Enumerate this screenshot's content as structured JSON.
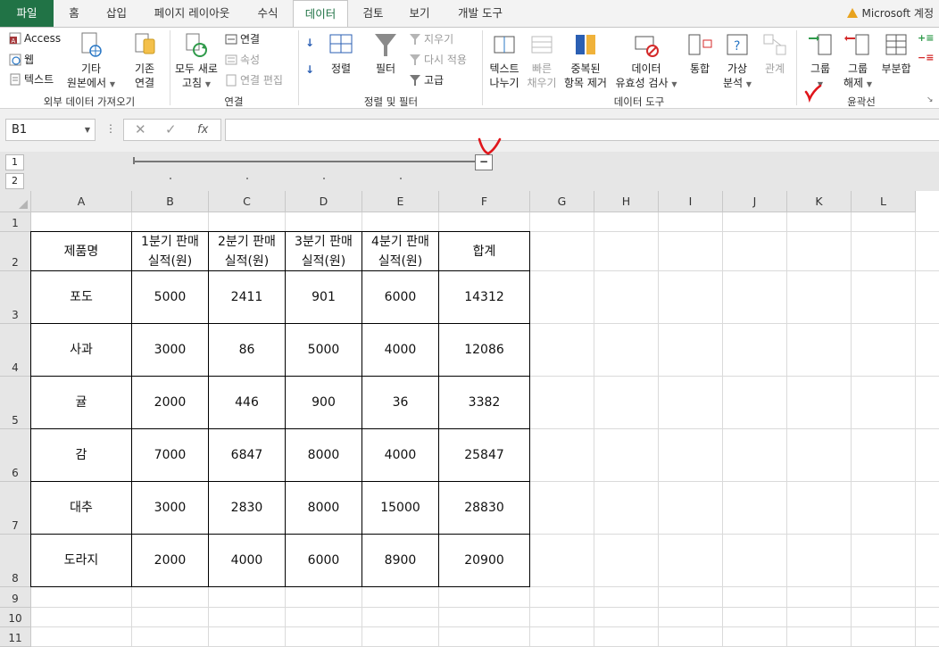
{
  "tabs": [
    "파일",
    "홈",
    "삽입",
    "페이지 레이아웃",
    "수식",
    "데이터",
    "검토",
    "보기",
    "개발 도구"
  ],
  "account": "Microsoft 계정",
  "ribbon": {
    "external": {
      "access": "Access",
      "web": "웹",
      "text": "텍스트",
      "other_line1": "기타",
      "other_line2": "원본에서",
      "existing_line1": "기존",
      "existing_line2": "연결",
      "group_label": "외부 데이터 가져오기"
    },
    "connections": {
      "refresh_line1": "모두 새로",
      "refresh_line2": "고침",
      "connections": "연결",
      "properties": "속성",
      "edit_links": "연결 편집",
      "group_label": "연결"
    },
    "sort_filter": {
      "sort": "정렬",
      "filter": "필터",
      "clear": "지우기",
      "reapply": "다시 적용",
      "advanced": "고급",
      "group_label": "정렬 및 필터"
    },
    "data_tools": {
      "text_to_columns_line1": "텍스트",
      "text_to_columns_line2": "나누기",
      "flash_fill_line1": "빠른",
      "flash_fill_line2": "채우기",
      "remove_dup_line1": "중복된",
      "remove_dup_line2": "항목 제거",
      "validation_line1": "데이터",
      "validation_line2": "유효성 검사",
      "consolidate": "통합",
      "whatif_line1": "가상",
      "whatif_line2": "분석",
      "relationships": "관계",
      "group_label": "데이터 도구"
    },
    "outline": {
      "group_line1": "그룹",
      "ungroup_line1": "그룹",
      "ungroup_line2": "해제",
      "subtotal": "부분합",
      "group_label": "윤곽선"
    }
  },
  "formula_bar": {
    "name_box": "B1",
    "dots": "⋮",
    "cancel": "✕",
    "enter": "✓",
    "fx": "fx",
    "value": ""
  },
  "outline_levels": [
    "1",
    "2"
  ],
  "outline_collapse": "−",
  "columns": [
    "A",
    "B",
    "C",
    "D",
    "E",
    "F",
    "G",
    "H",
    "I",
    "J",
    "K",
    "L"
  ],
  "rows": [
    "1",
    "2",
    "3",
    "4",
    "5",
    "6",
    "7",
    "8",
    "9",
    "10",
    "11"
  ],
  "table": {
    "headers": [
      "제품명",
      "1분기 판매\n실적(원)",
      "2분기 판매\n실적(원)",
      "3분기 판매\n실적(원)",
      "4분기 판매\n실적(원)",
      "합계"
    ],
    "rows": [
      [
        "포도",
        "5000",
        "2411",
        "901",
        "6000",
        "14312"
      ],
      [
        "사과",
        "3000",
        "86",
        "5000",
        "4000",
        "12086"
      ],
      [
        "귤",
        "2000",
        "446",
        "900",
        "36",
        "3382"
      ],
      [
        "감",
        "7000",
        "6847",
        "8000",
        "4000",
        "25847"
      ],
      [
        "대추",
        "3000",
        "2830",
        "8000",
        "15000",
        "28830"
      ],
      [
        "도라지",
        "2000",
        "4000",
        "6000",
        "8900",
        "20900"
      ]
    ]
  },
  "colors": {
    "excel_green": "#217346",
    "annotation_red": "#e0151b"
  }
}
